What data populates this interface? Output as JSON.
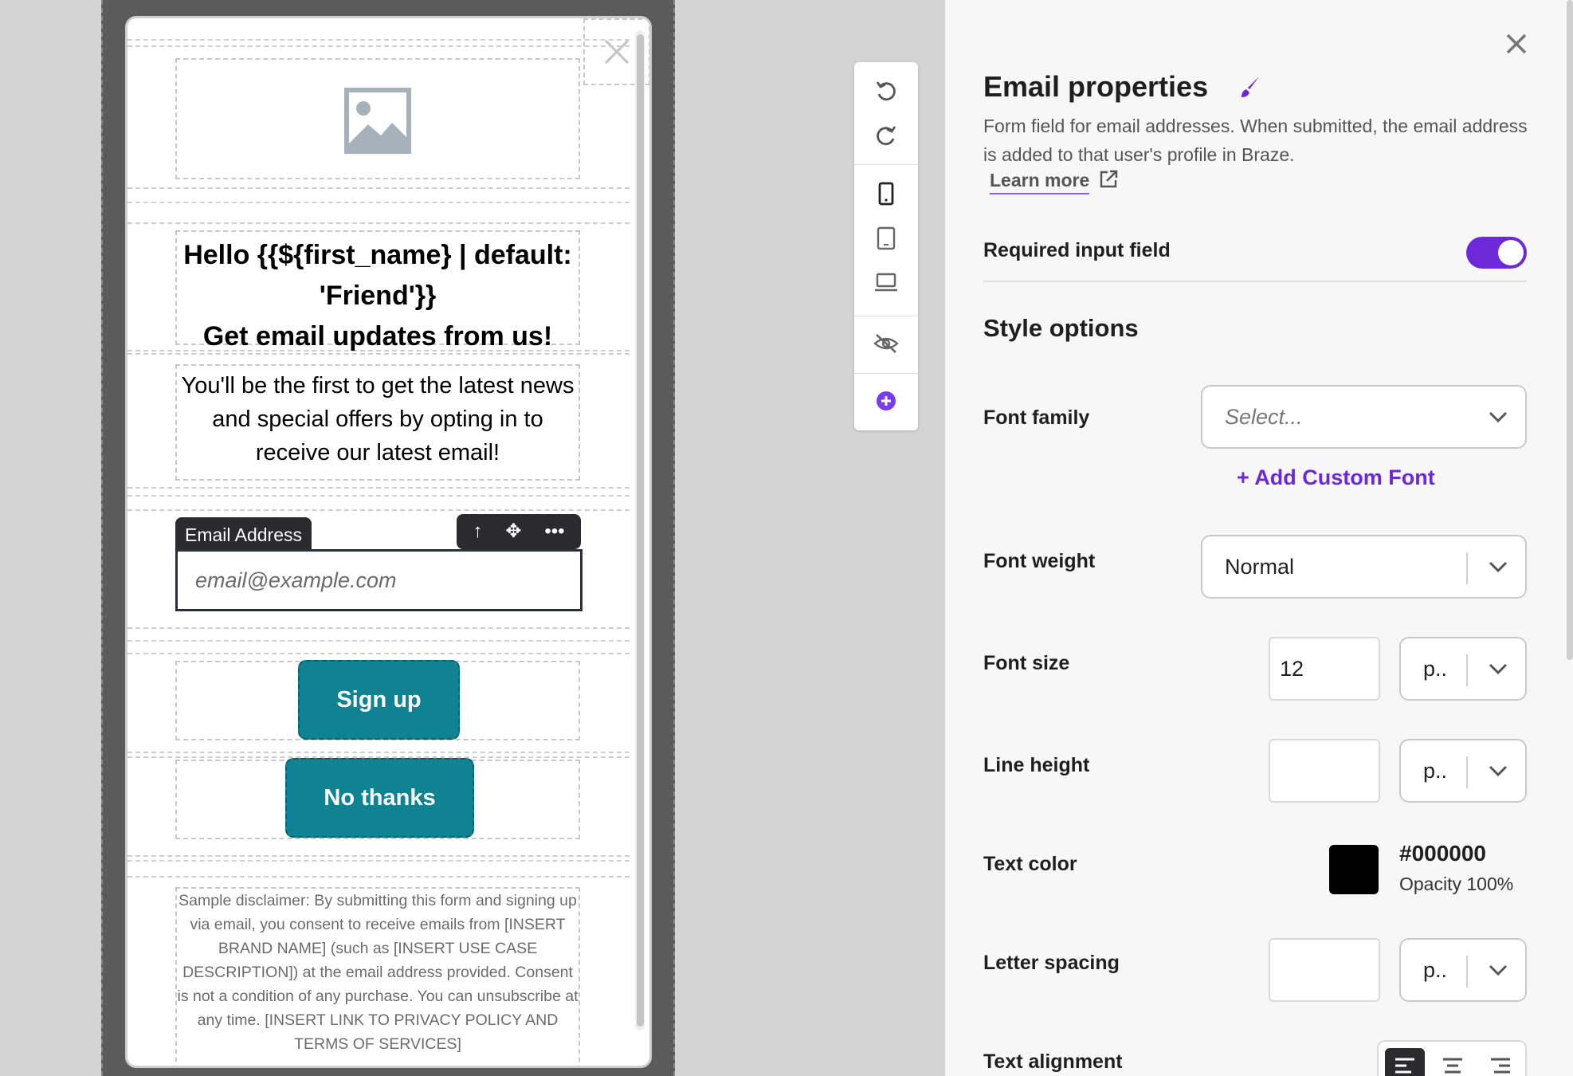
{
  "preview": {
    "headline_line1": "Hello {{${first_name} | default:",
    "headline_line2": "'Friend'}}",
    "headline_line3": "Get email updates from us!",
    "subtext": "You'll be the first to get the latest news and special offers by opting in to receive our latest email!",
    "field_label": "Email Address",
    "email_placeholder": "email@example.com",
    "signup_label": "Sign up",
    "nothanks_label": "No thanks",
    "disclaimer": "Sample disclaimer: By submitting this form and signing up via email, you consent to receive emails from [INSERT BRAND NAME] (such as [INSERT USE CASE DESCRIPTION]) at the email address provided. Consent is not a condition of any purchase. You can unsubscribe at any time. [INSERT LINK TO PRIVACY POLICY AND TERMS OF SERVICES]",
    "button_color": "#0f8391"
  },
  "toolbar": {
    "icons": [
      "undo-icon",
      "redo-icon",
      "mobile-icon",
      "tablet-icon",
      "desktop-icon",
      "hide-icon",
      "add-icon"
    ]
  },
  "panel": {
    "title": "Email properties",
    "description": "Form field for email addresses. When submitted, the email address is added to that user's profile in Braze.",
    "learn_more": "Learn more",
    "required_label": "Required input field",
    "required_on": true,
    "style_options": "Style options",
    "font_family_label": "Font family",
    "font_family_placeholder": "Select...",
    "add_custom_font": "+ Add Custom Font",
    "font_weight_label": "Font weight",
    "font_weight_value": "Normal",
    "font_size_label": "Font size",
    "font_size_value": "12",
    "unit_short": "p..",
    "line_height_label": "Line height",
    "line_height_value": "",
    "text_color_label": "Text color",
    "text_color_hex": "#000000",
    "text_color_opacity": "Opacity 100%",
    "letter_spacing_label": "Letter spacing",
    "letter_spacing_value": "",
    "text_alignment_label": "Text alignment",
    "accent_color": "#6d28d9"
  }
}
